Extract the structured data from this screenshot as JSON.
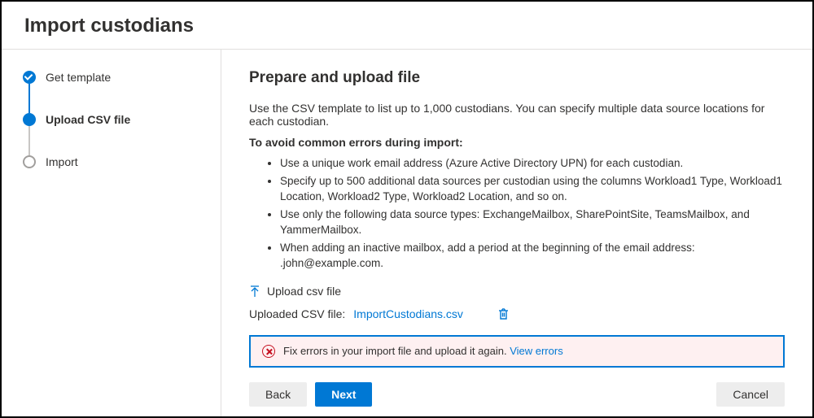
{
  "header": {
    "title": "Import custodians"
  },
  "stepper": {
    "steps": [
      {
        "label": "Get template"
      },
      {
        "label": "Upload CSV file"
      },
      {
        "label": "Import"
      }
    ]
  },
  "content": {
    "heading": "Prepare and upload file",
    "intro": "Use the CSV template to list up to 1,000 custodians. You can specify multiple data source locations for each custodian.",
    "subhead": "To avoid common errors during import:",
    "bullets": {
      "b0": "Use a unique work email address (Azure Active Directory UPN) for each custodian.",
      "b1": "Specify up to 500 additional data sources per custodian using the columns Workload1 Type, Workload1 Location, Workload2 Type, Workload2 Location, and so on.",
      "b2": "Use only the following data source types: ExchangeMailbox, SharePointSite, TeamsMailbox, and YammerMailbox.",
      "b3": "When adding an inactive mailbox, add a period at the beginning of the email address: .john@example.com."
    },
    "upload_label": "Upload csv file",
    "uploaded_label": "Uploaded CSV file:",
    "uploaded_filename": "ImportCustodians.csv",
    "error_msg": "Fix errors in your import file and upload it again. ",
    "error_link": "View errors"
  },
  "footer": {
    "back": "Back",
    "next": "Next",
    "cancel": "Cancel"
  }
}
